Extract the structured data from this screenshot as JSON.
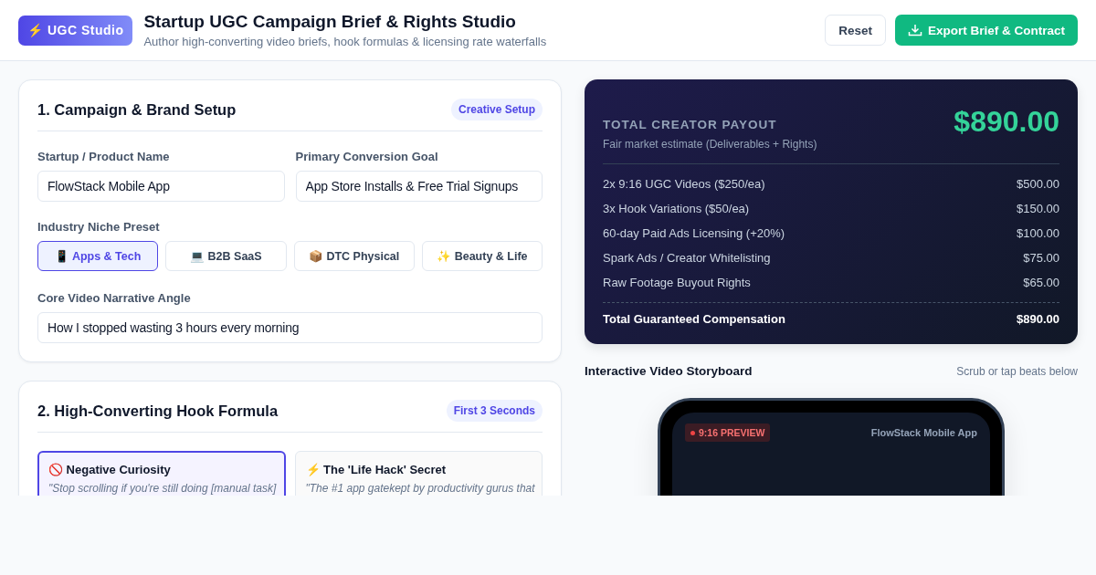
{
  "header": {
    "logo": "⚡ UGC Studio",
    "title": "Startup UGC Campaign Brief & Rights Studio",
    "subtitle": "Author high-converting video briefs, hook formulas & licensing rate waterfalls",
    "buttons": [
      {
        "kind": "secondary",
        "label": "Reset"
      },
      {
        "kind": "primary",
        "label": "Export Brief & Contract"
      }
    ]
  },
  "setup": {
    "title": "1. Campaign & Brand Setup",
    "badge": "Creative Setup",
    "fields": [
      {
        "label": "Startup / Product Name",
        "value": "FlowStack Mobile App"
      },
      {
        "label": "Primary Conversion Goal",
        "value": "App Store Installs & Free Trial Signups"
      }
    ],
    "niche_label": "Industry Niche Preset",
    "niches": [
      {
        "label": "📱 Apps & Tech",
        "selected": true
      },
      {
        "label": "💻 B2B SaaS",
        "selected": false
      },
      {
        "label": "📦 DTC Physical",
        "selected": false
      },
      {
        "label": "✨ Beauty & Life",
        "selected": false
      }
    ],
    "angle": {
      "label": "Core Video Narrative Angle",
      "value": "How I stopped wasting 3 hours every morning"
    }
  },
  "hooks": {
    "title": "2. High-Converting Hook Formula",
    "badge": "First 3 Seconds",
    "options": [
      {
        "title": "🚫 Negative Curiosity",
        "quote": "\"Stop scrolling if you're still doing [manual task]",
        "selected": true
      },
      {
        "title": "⚡ The 'Life Hack' Secret",
        "quote": "\"The #1 app gatekept by productivity gurus that",
        "selected": false
      }
    ]
  },
  "payout": {
    "label": "TOTAL CREATOR PAYOUT",
    "total": "$890.00",
    "note": "Fair market estimate (Deliverables + Rights)",
    "lines": [
      {
        "name": "2x 9:16 UGC Videos ($250/ea)",
        "amount": "$500.00"
      },
      {
        "name": "3x Hook Variations ($50/ea)",
        "amount": "$150.00"
      },
      {
        "name": "60-day Paid Ads Licensing (+20%)",
        "amount": "$100.00"
      },
      {
        "name": "Spark Ads / Creator Whitelisting",
        "amount": "$75.00"
      },
      {
        "name": "Raw Footage Buyout Rights",
        "amount": "$65.00"
      }
    ],
    "footer": {
      "name": "Total Guaranteed Compensation",
      "amount": "$890.00"
    }
  },
  "storyboard": {
    "title": "Interactive Video Storyboard",
    "hint": "Scrub or tap beats below",
    "preview_badge": "9:16 PREVIEW",
    "app_name": "FlowStack Mobile App"
  }
}
